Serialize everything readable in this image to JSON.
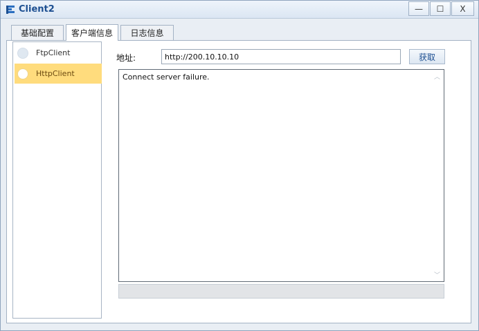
{
  "window": {
    "title": "Client2"
  },
  "title_buttons": {
    "minimize": "—",
    "maximize": "☐",
    "close": "X"
  },
  "tabs": [
    {
      "label": "基础配置"
    },
    {
      "label": "客户端信息"
    },
    {
      "label": "日志信息"
    }
  ],
  "active_tab": 1,
  "client_list": [
    {
      "label": "FtpClient",
      "selected": false
    },
    {
      "label": "HttpClient",
      "selected": true
    }
  ],
  "address": {
    "label": "地址:",
    "value": "http://200.10.10.10"
  },
  "fetch_button": {
    "label": "获取"
  },
  "output": {
    "text": "Connect server failure."
  },
  "scrollbar": {
    "up": "︿",
    "down": "﹀"
  }
}
